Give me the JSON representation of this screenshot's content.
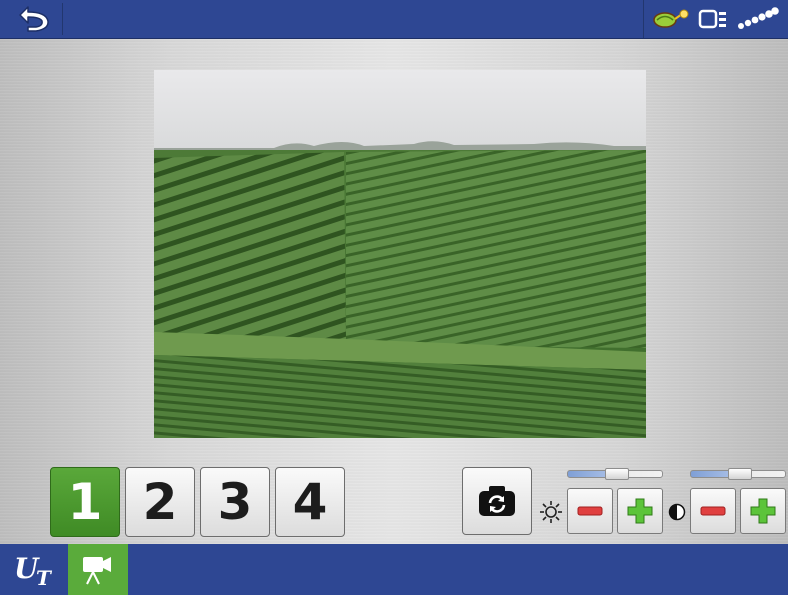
{
  "top_bar": {
    "back_icon": "back-arrow-icon",
    "status_icons": [
      "implement-seed-icon",
      "display-module-icon",
      "gps-signal-icon"
    ]
  },
  "camera": {
    "feed_icon": "field-camera-image",
    "buttons": [
      {
        "label": "1",
        "selected": true
      },
      {
        "label": "2",
        "selected": false
      },
      {
        "label": "3",
        "selected": false
      },
      {
        "label": "4",
        "selected": false
      }
    ]
  },
  "controls": {
    "snapshot_icon": "camera-rotate-icon",
    "brightness": {
      "icon": "sun-icon",
      "level": 0.5
    },
    "contrast": {
      "icon": "contrast-icon",
      "level": 0.5
    }
  },
  "bottom_bar": {
    "logo_u": "U",
    "logo_t": "T",
    "active_tab_icon": "video-camera-icon"
  },
  "colors": {
    "bar_blue": "#2e4793",
    "accent_green": "#5aab3b",
    "minus_red": "#e04040",
    "plus_green": "#5cc43a"
  }
}
